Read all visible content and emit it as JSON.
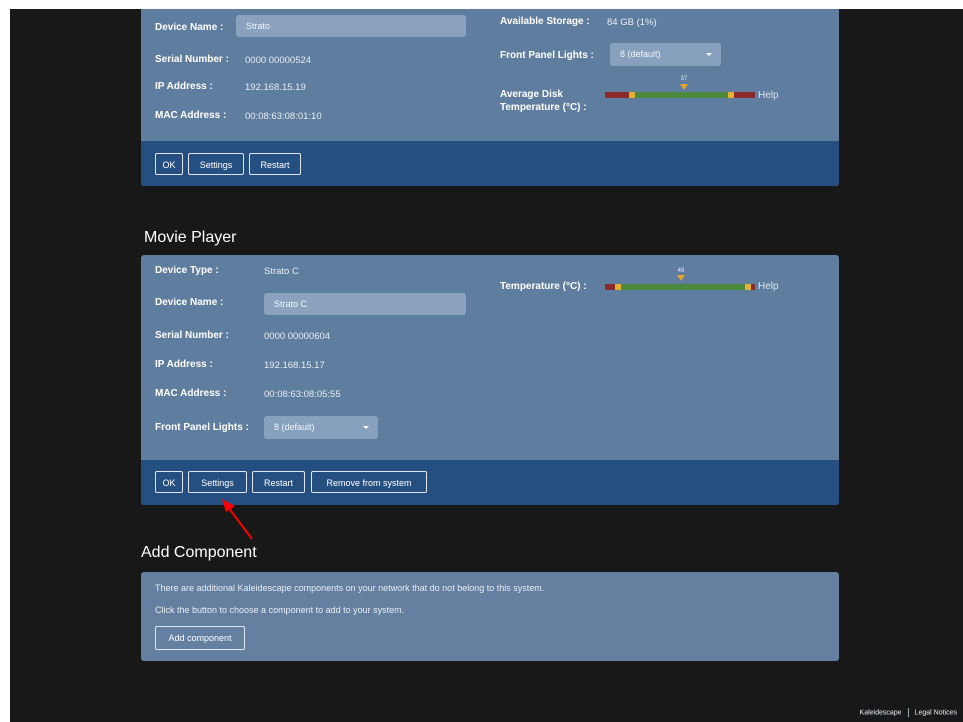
{
  "colors": {
    "page_bg": "#181818",
    "panel_bg": "#5f7d9f",
    "panel_footer_bg": "#254f80",
    "temp_red": "#8b2a2a",
    "temp_yellow": "#e2b132",
    "temp_green": "#4d8a3d",
    "annotation_arrow": "#ff0000"
  },
  "server": {
    "device_name_label": "Device Name :",
    "device_name_value": "Strato",
    "serial_label": "Serial Number :",
    "serial_value": "0000 00000524",
    "ip_label": "IP Address :",
    "ip_value": "192.168.15.19",
    "mac_label": "MAC Address :",
    "mac_value": "00:08:63:08:01:10",
    "storage_label": "Available Storage :",
    "storage_value": "84 GB (1%)",
    "lights_label": "Front Panel Lights :",
    "lights_value": "8 (default)",
    "disk_temp_label_1": "Average Disk",
    "disk_temp_label_2": "Temperature (°C) :",
    "disk_temp_value": "37",
    "disk_temp_fraction": 0.54,
    "help": "Help",
    "ok": "OK",
    "settings": "Settings",
    "restart": "Restart"
  },
  "movie_player": {
    "heading": "Movie Player",
    "device_type_label": "Device Type :",
    "device_type_value": "Strato C",
    "device_name_label": "Device Name :",
    "device_name_value": "Strato C",
    "serial_label": "Serial Number :",
    "serial_value": "0000 00000604",
    "ip_label": "IP Address :",
    "ip_value": "192.168.15.17",
    "mac_label": "MAC Address :",
    "mac_value": "00:08:63:08:05:55",
    "lights_label": "Front Panel Lights :",
    "lights_value": "8 (default)",
    "temp_label": "Temperature (°C) :",
    "temp_value": "49",
    "temp_fraction": 0.51,
    "help": "Help",
    "ok": "OK",
    "settings": "Settings",
    "restart": "Restart",
    "remove": "Remove from system"
  },
  "add_component": {
    "heading": "Add Component",
    "line1": "There are additional Kaleidescape components on your network that do not belong to this system.",
    "line2": "Click the button to choose a component to add to your system.",
    "button": "Add component"
  },
  "footer": {
    "brand": "Kaleidescape",
    "legal": "Legal Notices"
  }
}
